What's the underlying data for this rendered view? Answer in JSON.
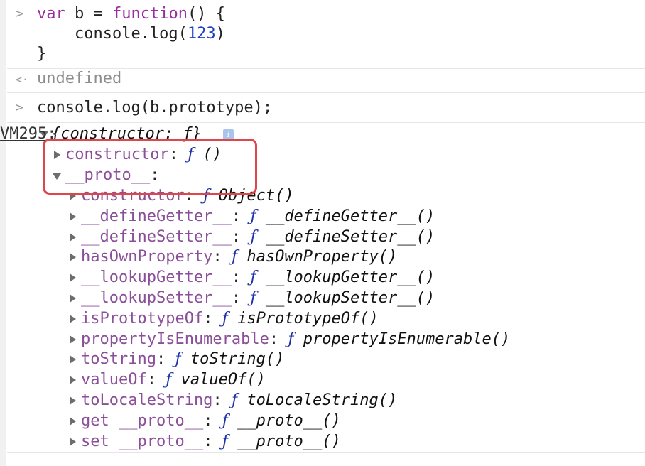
{
  "console": {
    "input1": {
      "line1": {
        "kw1": "var",
        "mid1": " b = ",
        "kw2": "function",
        "rest": "() {"
      },
      "line2": {
        "pre": "    console.log(",
        "num": "123",
        "post": ")"
      },
      "line3": "}"
    },
    "result1": "undefined",
    "input2": "console.log(b.prototype);",
    "output": {
      "summary": "{constructor: ƒ}",
      "source_link": "VM295:",
      "constructor": {
        "key": "constructor",
        "sep": ": ",
        "f": "ƒ",
        "value": " ()"
      },
      "proto": {
        "key": "__proto__",
        "sep": ":"
      },
      "proto_items": [
        {
          "key": "constructor",
          "sep": ": ",
          "f": "ƒ",
          "value": " Object()"
        },
        {
          "key": "__defineGetter__",
          "sep": ": ",
          "f": "ƒ",
          "value": " __defineGetter__()"
        },
        {
          "key": "__defineSetter__",
          "sep": ": ",
          "f": "ƒ",
          "value": " __defineSetter__()"
        },
        {
          "key": "hasOwnProperty",
          "sep": ": ",
          "f": "ƒ",
          "value": " hasOwnProperty()"
        },
        {
          "key": "__lookupGetter__",
          "sep": ": ",
          "f": "ƒ",
          "value": " __lookupGetter__()"
        },
        {
          "key": "__lookupSetter__",
          "sep": ": ",
          "f": "ƒ",
          "value": " __lookupSetter__()"
        },
        {
          "key": "isPrototypeOf",
          "sep": ": ",
          "f": "ƒ",
          "value": " isPrototypeOf()"
        },
        {
          "key": "propertyIsEnumerable",
          "sep": ": ",
          "f": "ƒ",
          "value": " propertyIsEnumerable()"
        },
        {
          "key": "toString",
          "sep": ": ",
          "f": "ƒ",
          "value": " toString()"
        },
        {
          "key": "valueOf",
          "sep": ": ",
          "f": "ƒ",
          "value": " valueOf()"
        },
        {
          "key": "toLocaleString",
          "sep": ": ",
          "f": "ƒ",
          "value": " toLocaleString()"
        },
        {
          "key": "get __proto__",
          "sep": ": ",
          "f": "ƒ",
          "value": " __proto__()"
        },
        {
          "key": "set __proto__",
          "sep": ": ",
          "f": "ƒ",
          "value": " __proto__()"
        }
      ]
    }
  },
  "icons": {
    "prompt": "chevron-right-icon",
    "result": "back-arrow-icon",
    "info": "info-icon"
  }
}
